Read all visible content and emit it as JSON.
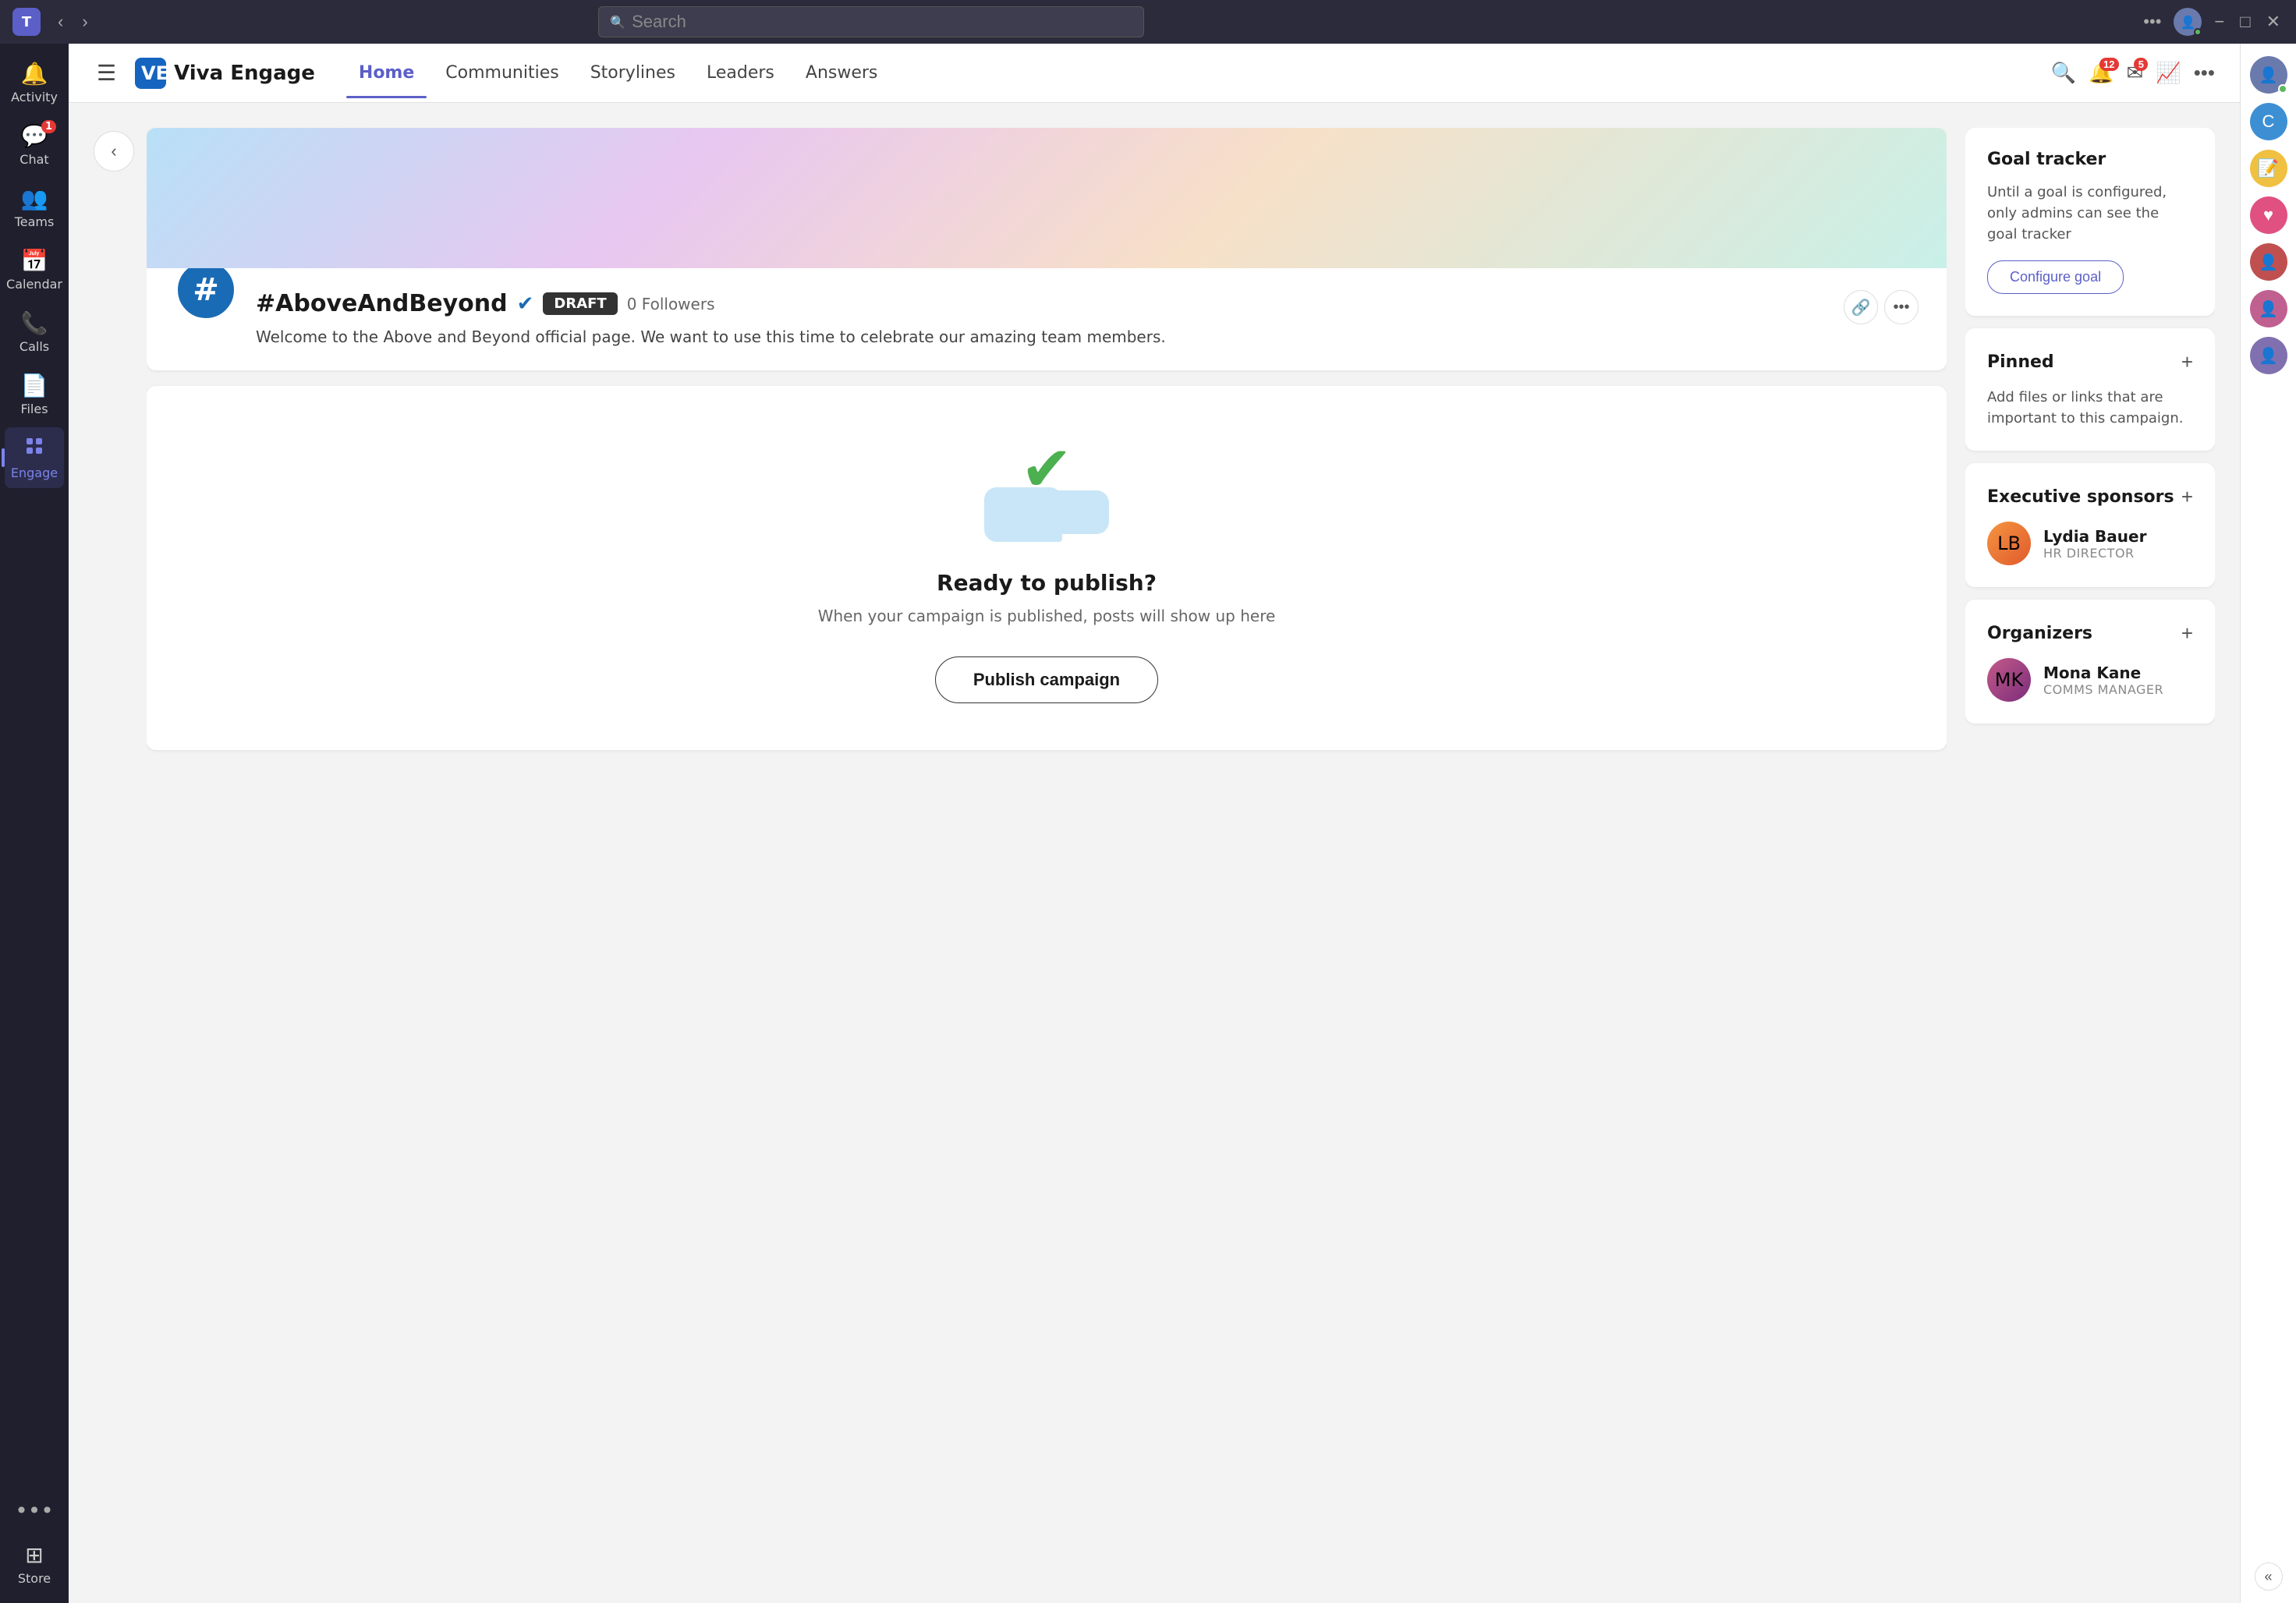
{
  "titlebar": {
    "search_placeholder": "Search",
    "nav_back": "‹",
    "nav_forward": "›",
    "more_label": "•••",
    "minimize": "−",
    "maximize": "□",
    "close": "✕"
  },
  "sidebar": {
    "items": [
      {
        "id": "activity",
        "label": "Activity",
        "icon": "🔔",
        "badge": null,
        "active": false
      },
      {
        "id": "chat",
        "label": "Chat",
        "icon": "💬",
        "badge": "1",
        "active": false
      },
      {
        "id": "teams",
        "label": "Teams",
        "icon": "👥",
        "badge": null,
        "active": false
      },
      {
        "id": "calendar",
        "label": "Calendar",
        "icon": "📅",
        "badge": null,
        "active": false
      },
      {
        "id": "calls",
        "label": "Calls",
        "icon": "📞",
        "badge": null,
        "active": false
      },
      {
        "id": "files",
        "label": "Files",
        "icon": "📄",
        "badge": null,
        "active": false
      },
      {
        "id": "engage",
        "label": "Engage",
        "icon": "⚡",
        "badge": null,
        "active": true
      }
    ],
    "more": "•••",
    "store_label": "Store",
    "store_icon": "⊞"
  },
  "topnav": {
    "hamburger": "☰",
    "app_name": "Viva Engage",
    "nav_links": [
      {
        "id": "home",
        "label": "Home",
        "active": true
      },
      {
        "id": "communities",
        "label": "Communities",
        "active": false
      },
      {
        "id": "storylines",
        "label": "Storylines",
        "active": false
      },
      {
        "id": "leaders",
        "label": "Leaders",
        "active": false
      },
      {
        "id": "answers",
        "label": "Answers",
        "active": false
      }
    ],
    "search_icon": "🔍",
    "notifications_badge": "12",
    "messages_badge": "5",
    "analytics_icon": "📈",
    "more_icon": "•••"
  },
  "campaign": {
    "back_label": "‹",
    "logo_symbol": "#",
    "title": "#AboveAndBeyond",
    "verified": true,
    "draft_label": "DRAFT",
    "followers": "0 Followers",
    "description": "Welcome to the Above and Beyond official page. We want to use this time to\ncelebrate our amazing team members.",
    "link_icon": "🔗",
    "more_icon": "•••"
  },
  "publish": {
    "ready_title": "Ready to publish?",
    "ready_subtitle": "When your campaign is published, posts will show up here",
    "publish_btn_label": "Publish campaign"
  },
  "goal_tracker": {
    "title": "Goal tracker",
    "description": "Until a goal is configured, only admins can see the goal tracker",
    "configure_btn": "Configure goal"
  },
  "pinned": {
    "title": "Pinned",
    "description": "Add files or links that are important to this campaign."
  },
  "executive_sponsors": {
    "title": "Executive sponsors",
    "people": [
      {
        "name": "Lydia Bauer",
        "role": "HR DIRECTOR",
        "avatar_color": "lydia"
      }
    ]
  },
  "organizers": {
    "title": "Organizers",
    "people": [
      {
        "name": "Mona Kane",
        "role": "COMMS MANAGER",
        "avatar_color": "mona"
      }
    ]
  },
  "far_right": {
    "collapse_icon": "«",
    "avatars": [
      {
        "id": "user1",
        "color": "blue"
      },
      {
        "id": "user2",
        "color": "teal"
      },
      {
        "id": "user3",
        "color": "red"
      },
      {
        "id": "user4",
        "color": "pink"
      },
      {
        "id": "user5",
        "color": "orange"
      },
      {
        "id": "user6",
        "color": "purple"
      }
    ]
  }
}
